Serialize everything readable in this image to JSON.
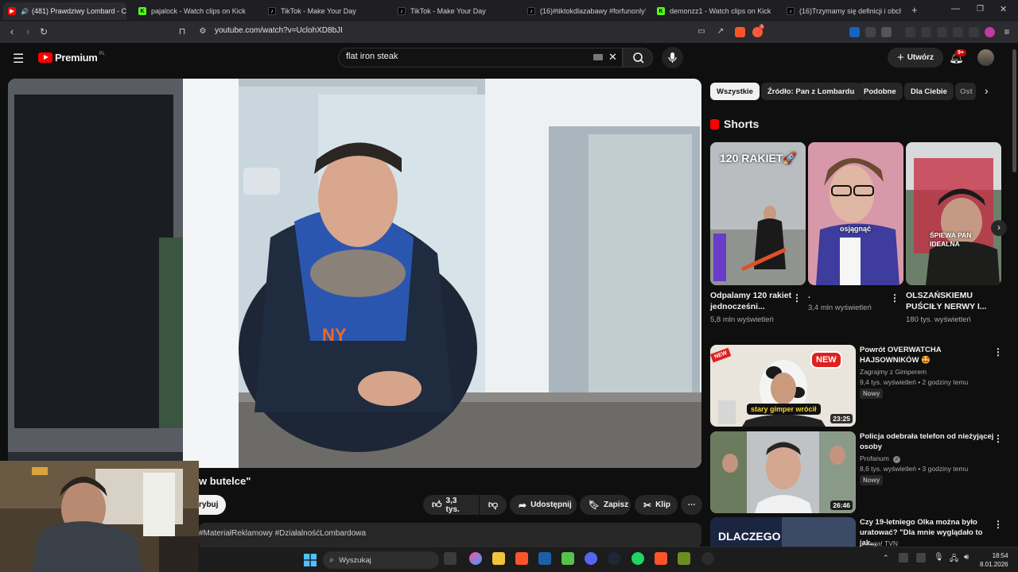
{
  "browser": {
    "tabs": [
      {
        "label": "(481) Prawdziwy Lombard - C",
        "active": true
      },
      {
        "label": "pajalock - Watch clips on Kick"
      },
      {
        "label": "TikTok - Make Your Day"
      },
      {
        "label": "TikTok - Make Your Day"
      },
      {
        "label": "(16)#tiktokdlazabawy #forfunonly💜"
      },
      {
        "label": "demonzz1 - Watch clips on Kick"
      },
      {
        "label": "(16)Trzymamy się definicji i obchodz"
      }
    ],
    "url": "youtube.com/watch?v=UclohXD8bJI",
    "extension_badge": "3"
  },
  "header": {
    "logo_text": "Premium",
    "logo_region": "PL",
    "search_value": "flat iron steak",
    "create_label": "Utwórz",
    "notifications_badge": "9+"
  },
  "video": {
    "title_visible": "w butelce\"",
    "subscribe_label": "rybuj",
    "likes": "3,3 tys.",
    "share_label": "Udostępnij",
    "save_label": "Zapisz",
    "clip_label": "Klip",
    "description_snippet": "#MateriałReklamowy #DziałalnośćLombardowa"
  },
  "filters": [
    "Wszystkie",
    "Źródło: Pan z Lombardu",
    "Podobne",
    "Dla Ciebie",
    "Ost"
  ],
  "shorts": {
    "heading": "Shorts",
    "items": [
      {
        "title": "Odpalamy 120 rakiet jednocześni...",
        "views": "5,8 mln wyświetleń",
        "overlay": "120 RAKIET🚀"
      },
      {
        "title": ".",
        "views": "3,4 mln wyświetleń",
        "overlay": "osjągnąć"
      },
      {
        "title": "OLSZAŃSKIEMU PUŚCIŁY NERWY I...",
        "views": "180 tys. wyświetleń",
        "overlay": "ŚPIEWA PAN IDEALNA"
      }
    ]
  },
  "videos": [
    {
      "title": "Powrót OVERWATCHA HAJSOWNIKÓW 🤩",
      "channel": "Zagrajmy z Gimperem",
      "meta": "9,4 tys. wyświetleń • 2 godziny temu",
      "badge": "Nowy",
      "duration": "23:25",
      "thumb_text": "stary gimper wrócił",
      "thumb_badge": "NEW",
      "corner": "NEW"
    },
    {
      "title": "Policja odebrała telefon od nieżyjącej osoby",
      "channel": "Profanum",
      "meta": "8,6 tys. wyświetleń • 3 godziny temu",
      "badge": "Nowy",
      "duration": "26:46"
    },
    {
      "title": "Czy 19-letniego Olka można było uratować? \"Dla mnie wyglądało to jak...",
      "channel": "Uwaga! TVN",
      "thumb_text": "DLACZEGO"
    }
  ],
  "taskbar": {
    "search_placeholder": "Wyszukaj",
    "time": "18:54",
    "date": "8.01.2026"
  },
  "colors": {
    "yt_red": "#ff0000",
    "kick_green": "#53fc18",
    "background": "#0f0f0f"
  }
}
